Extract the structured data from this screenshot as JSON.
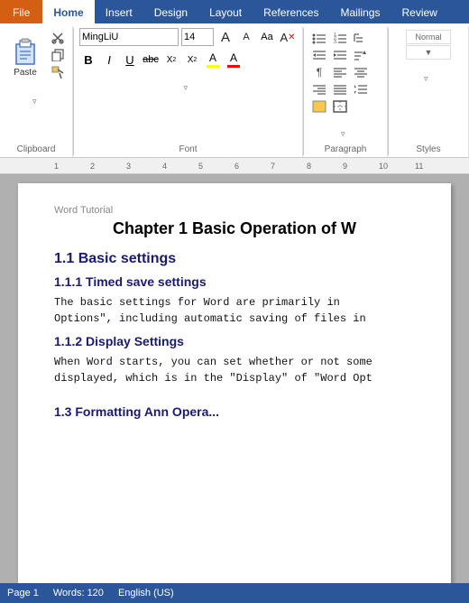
{
  "tabs": [
    {
      "label": "File",
      "id": "file",
      "active": false
    },
    {
      "label": "Home",
      "id": "home",
      "active": true
    },
    {
      "label": "Insert",
      "id": "insert",
      "active": false
    },
    {
      "label": "Design",
      "id": "design",
      "active": false
    },
    {
      "label": "Layout",
      "id": "layout",
      "active": false
    },
    {
      "label": "References",
      "id": "references",
      "active": false
    },
    {
      "label": "Mailings",
      "id": "mailings",
      "active": false
    },
    {
      "label": "Review",
      "id": "review",
      "active": false
    }
  ],
  "clipboard": {
    "paste_label": "Paste",
    "cut_label": "Cut",
    "copy_label": "Copy",
    "format_label": "Format Painter",
    "group_label": "Clipboard"
  },
  "font": {
    "name": "MingLiU",
    "size": "14",
    "group_label": "Font",
    "bold": "B",
    "italic": "I",
    "underline": "U",
    "strikethrough": "abc",
    "subscript": "X₂",
    "superscript": "X²",
    "grow": "A",
    "shrink": "A",
    "clear": "A",
    "change_case": "Aa",
    "highlight": "A",
    "color": "A"
  },
  "paragraph": {
    "group_label": "Paragraph"
  },
  "document": {
    "label": "Word Tutorial",
    "chapter_title": "Chapter 1 Basic Operation of W",
    "h1_1": "1.1 Basic settings",
    "h2_1": "1.1.1 Timed save settings",
    "body1": "The basic settings for Word are primarily in",
    "body1b": "Options\", including automatic saving of files in",
    "h2_2": "1.1.2 Display Settings",
    "body2": "When Word starts, you can set whether or not some",
    "body2b": "displayed, which is in the \"Display\" of \"Word Opt",
    "h2_3": "1.3 Formatting Ann Opera..."
  },
  "status": {
    "page": "Page 1",
    "words": "Words: 120",
    "language": "English (US)"
  }
}
